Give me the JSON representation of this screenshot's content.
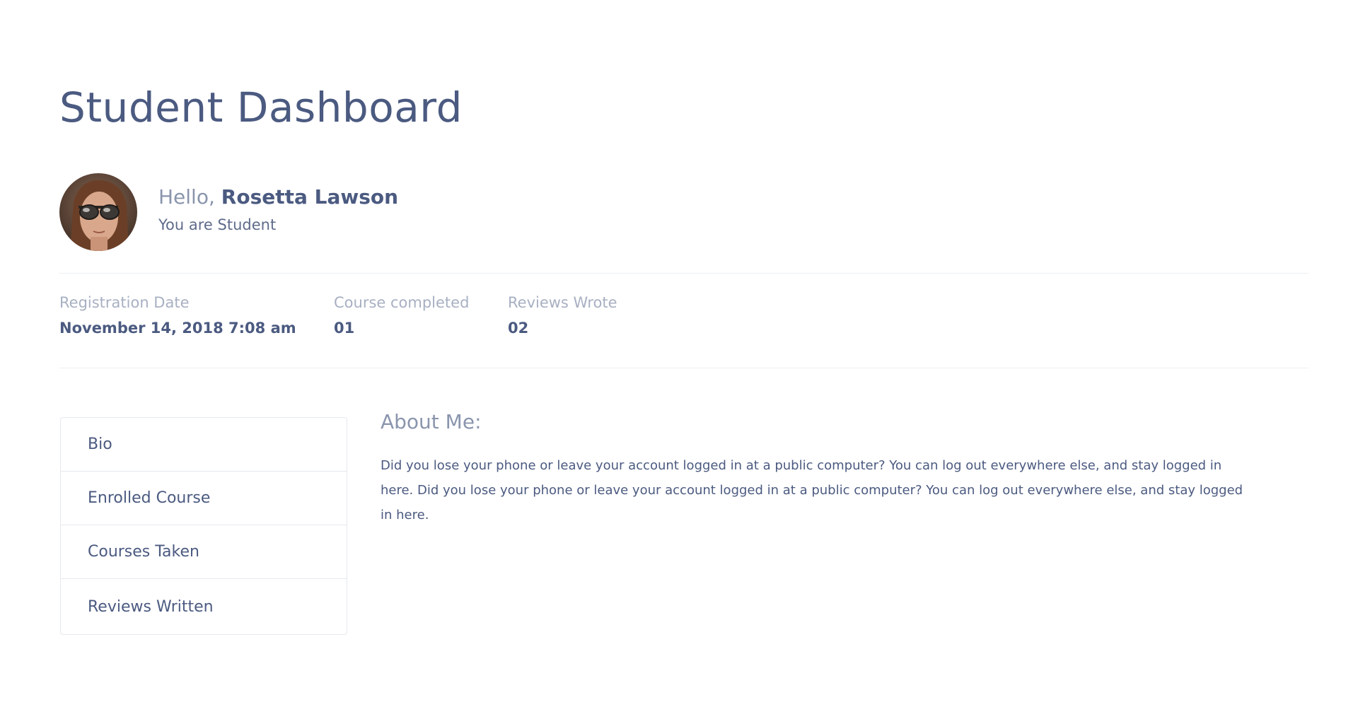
{
  "page": {
    "title": "Student Dashboard"
  },
  "profile": {
    "greeting": "Hello,",
    "name": "Rosetta Lawson",
    "role": "You are Student"
  },
  "stats": [
    {
      "label": "Registration Date",
      "value": "November 14, 2018 7:08 am"
    },
    {
      "label": "Course completed",
      "value": "01"
    },
    {
      "label": "Reviews Wrote",
      "value": "02"
    }
  ],
  "tabs": [
    {
      "label": "Bio"
    },
    {
      "label": "Enrolled Course"
    },
    {
      "label": "Courses Taken"
    },
    {
      "label": "Reviews Written"
    }
  ],
  "about": {
    "title": "About Me:",
    "text": "Did you lose your phone or leave your account logged in at a public computer? You can log out everywhere else, and stay logged in here. Did you lose your phone or leave your account logged in at a public computer? You can log out everywhere else, and stay logged in here."
  },
  "colors": {
    "primary_text": "#4b5a80",
    "muted_text": "#a8b0c2",
    "border": "#e4e8ee"
  }
}
